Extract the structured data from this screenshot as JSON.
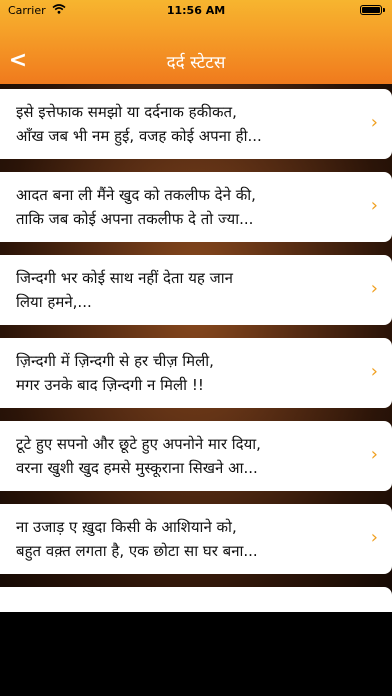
{
  "status": {
    "carrier": "Carrier",
    "time": "11:56 AM"
  },
  "nav": {
    "title": "दर्द स्टेटस",
    "back": "<"
  },
  "items": [
    {
      "line1": "इसे इत्तेफाक समझो या दर्दनाक हकीकत,",
      "line2": "आँख जब भी नम हुई, वजह कोई अपना ही..."
    },
    {
      "line1": "आदत बना ली मैंने खुद को तकलीफ देने की,",
      "line2": "ताकि जब कोई अपना तकलीफ दे तो ज्या..."
    },
    {
      "line1": "जिन्दगी भर कोई साथ नहीं देता यह जान",
      "line2": "लिया हमने,..."
    },
    {
      "line1": "ज़िन्दगी में ज़िन्दगी से हर चीज़ मिली,",
      "line2": "मगर उनके बाद ज़िन्दगी न मिली !!"
    },
    {
      "line1": "टूटे हुए सपनो और छूटे हुए अपनोने मार दिया,",
      "line2": "वरना खुशी खुद हमसे मुस्कूराना सिखने आ..."
    },
    {
      "line1": "ना उजाड़ ए ख़ुदा किसी के आशियाने को,",
      "line2": "बहुत वक़्त लगता है, एक छोटा सा घर बना..."
    }
  ],
  "chevron": "›"
}
